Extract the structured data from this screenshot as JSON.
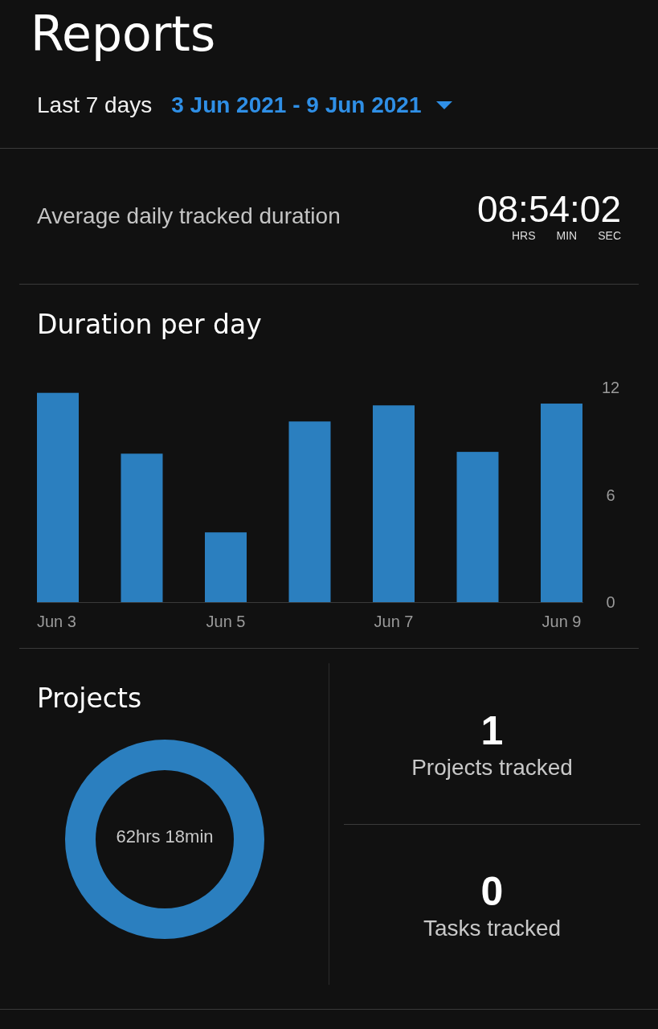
{
  "header": {
    "title": "Reports"
  },
  "range": {
    "label": "Last 7 days",
    "dates": "3 Jun 2021 - 9 Jun 2021"
  },
  "average": {
    "label": "Average daily tracked duration",
    "time": "08:54:02",
    "units": [
      "HRS",
      "MIN",
      "SEC"
    ]
  },
  "duration_chart": {
    "title": "Duration per day",
    "chart_data": {
      "type": "bar",
      "categories": [
        "Jun 3",
        null,
        "Jun 5",
        null,
        "Jun 7",
        null,
        "Jun 9"
      ],
      "values": [
        11.7,
        8.3,
        3.9,
        10.1,
        11.0,
        8.4,
        11.1
      ],
      "ylim": [
        0,
        12
      ],
      "yticks": [
        0,
        6,
        12
      ]
    }
  },
  "projects": {
    "title": "Projects",
    "total": "62hrs 18min"
  },
  "stats": [
    {
      "value": "1",
      "label": "Projects tracked"
    },
    {
      "value": "0",
      "label": "Tasks tracked"
    }
  ]
}
